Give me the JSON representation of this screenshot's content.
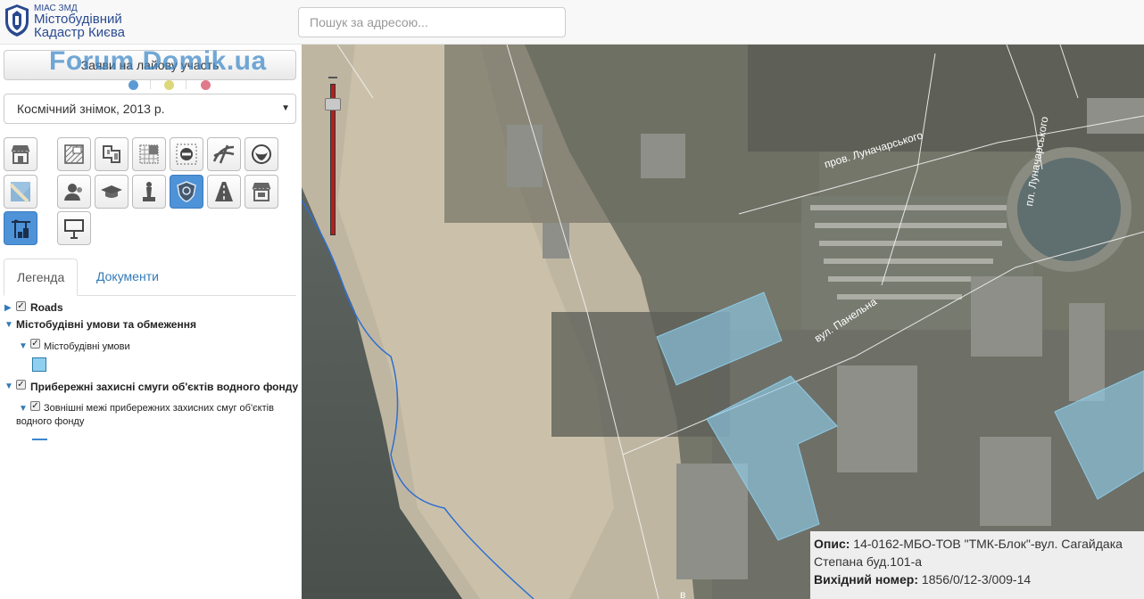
{
  "header": {
    "logo_small": "МІАС ЗМД",
    "logo_line1": "Містобудівний",
    "logo_line2": "Кадастр Києва",
    "search_placeholder": "Пошук за адресою..."
  },
  "sidebar": {
    "proposal_button": "Заяви на лайову участь",
    "watermark": "Forum Domik.ua",
    "watermark_colors": [
      "#5b9bd5",
      "#dcd77a",
      "#e07a8a"
    ],
    "basemap": "Космічний знімок, 2013 р.",
    "layer_buttons": [
      {
        "icon": "shop-icon",
        "active": false
      },
      {
        "icon": "hatched-plan-icon",
        "active": false
      },
      {
        "icon": "puzzle-plan-icon",
        "active": false
      },
      {
        "icon": "grid-plan-icon",
        "active": false
      },
      {
        "icon": "no-entry-icon",
        "active": false
      },
      {
        "icon": "road-junction-icon",
        "active": false
      },
      {
        "icon": "globe-outline-icon",
        "active": false
      },
      {
        "icon": "map-icon",
        "active": false
      },
      {
        "icon": "person-icon",
        "active": false
      },
      {
        "icon": "graduation-cap-icon",
        "active": false
      },
      {
        "icon": "monument-icon",
        "active": false
      },
      {
        "icon": "police-badge-icon",
        "active": true
      },
      {
        "icon": "road-icon",
        "active": false
      },
      {
        "icon": "market-icon",
        "active": false
      },
      {
        "icon": "construction-crane-icon",
        "active": true
      },
      {
        "icon": "billboard-icon",
        "active": false
      }
    ],
    "tabs": [
      {
        "label": "Легенда",
        "active": true
      },
      {
        "label": "Документи",
        "active": false
      }
    ],
    "legend": {
      "roads": "Roads",
      "urban_conditions_group": "Містобудівні умови та обмеження",
      "urban_conditions": "Містобудівні умови",
      "water_protection_group": "Прибережні захисні смуги об'єктів водного фонду",
      "water_protection_bounds_line1": "Зовнішні межі прибережних захисних смуг об'єктів",
      "water_protection_bounds_line2": "водного фонду",
      "urban_conditions_color": "#8fd0f0",
      "water_protection_color": "#3a86d0"
    }
  },
  "map": {
    "street_lunacharskoho_lane": "пров. Луначарського",
    "square_lunacharskoho": "пл. Луначарського",
    "street_panelnia": "вул. Панельна",
    "street_bottom": "в",
    "info": {
      "description_label": "Опис:",
      "description_value": "14-0162-МБО-ТОВ \"ТМК-Блок\"-вул. Сагайдака",
      "description_value_cont": "Степана буд.101-а",
      "number_label": "Вихідний номер:",
      "number_value": "1856/0/12-3/009-14"
    },
    "polygon_fill": "#8fd0f0"
  }
}
